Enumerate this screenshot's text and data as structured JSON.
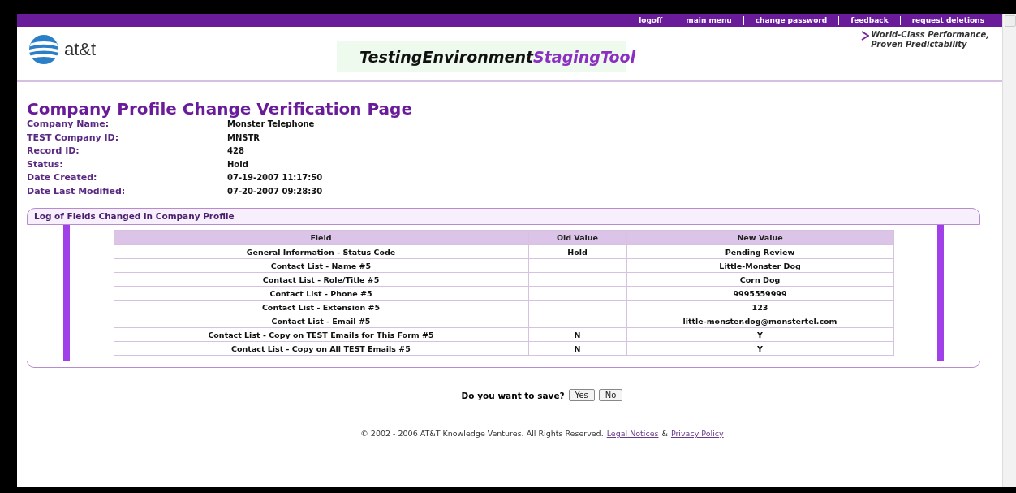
{
  "nav_links": [
    "logoff",
    "main menu",
    "change password",
    "feedback",
    "request deletions"
  ],
  "header": {
    "logo_text": "at&t",
    "title_main": "TestingEnvironment",
    "title_accent": "StagingTool",
    "tagline": [
      "World-Class Performance,",
      "Proven Predictability"
    ]
  },
  "page_title": "Company Profile Change Verification Page",
  "details": [
    {
      "label": "Company Name:",
      "value": "Monster Telephone"
    },
    {
      "label": "TEST Company ID:",
      "value": "MNSTR"
    },
    {
      "label": "Record ID:",
      "value": "428"
    },
    {
      "label": "Status:",
      "value": "Hold"
    },
    {
      "label": "Date Created:",
      "value": "07-19-2007 11:17:50"
    },
    {
      "label": "Date Last Modified:",
      "value": "07-20-2007 09:28:30"
    }
  ],
  "log": {
    "title": "Log of Fields Changed in Company Profile",
    "columns": [
      "Field",
      "Old Value",
      "New Value"
    ],
    "rows": [
      [
        "General Information - Status Code",
        "Hold",
        "Pending Review"
      ],
      [
        "Contact List - Name #5",
        "",
        "Little-Monster Dog"
      ],
      [
        "Contact List - Role/Title #5",
        "",
        "Corn Dog"
      ],
      [
        "Contact List - Phone #5",
        "",
        "9995559999"
      ],
      [
        "Contact List - Extension #5",
        "",
        "123"
      ],
      [
        "Contact List - Email #5",
        "",
        "little-monster.dog@monstertel.com"
      ],
      [
        "Contact List - Copy on TEST Emails for This Form #5",
        "N",
        "Y"
      ],
      [
        "Contact List - Copy on All TEST Emails #5",
        "N",
        "Y"
      ]
    ]
  },
  "save_prompt": {
    "question": "Do you want to save?",
    "buttons": [
      "Yes",
      "No"
    ]
  },
  "footer": {
    "text": "© 2002 - 2006 AT&T Knowledge Ventures. All Rights Reserved.",
    "links": [
      "Legal Notices",
      "Privacy Policy"
    ],
    "separator": "&"
  }
}
